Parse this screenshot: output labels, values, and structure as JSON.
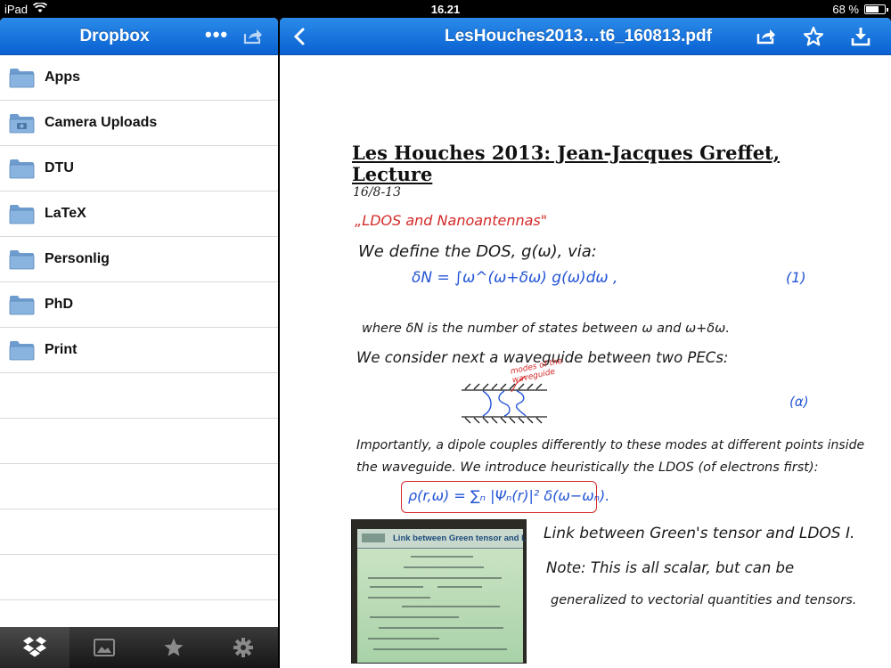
{
  "status_bar": {
    "device": "iPad",
    "time": "16.21",
    "battery": "68 %",
    "battery_level": 0.68
  },
  "sidebar": {
    "title": "Dropbox",
    "more_label": "•••",
    "folders": [
      {
        "label": "Apps",
        "icon": "folder-icon"
      },
      {
        "label": "Camera Uploads",
        "icon": "camera-folder-icon"
      },
      {
        "label": "DTU",
        "icon": "folder-icon"
      },
      {
        "label": "LaTeX",
        "icon": "folder-icon"
      },
      {
        "label": "Personlig",
        "icon": "folder-icon"
      },
      {
        "label": "PhD",
        "icon": "folder-icon"
      },
      {
        "label": "Print",
        "icon": "folder-icon"
      }
    ],
    "tabs": [
      {
        "icon": "dropbox-icon",
        "active": true
      },
      {
        "icon": "photos-icon",
        "active": false
      },
      {
        "icon": "star-icon",
        "active": false
      },
      {
        "icon": "gear-icon",
        "active": false
      }
    ]
  },
  "viewer": {
    "title": "LesHouches2013…t6_160813.pdf",
    "icons": [
      "back-icon",
      "share-icon",
      "star-icon",
      "download-icon"
    ]
  },
  "document": {
    "heading": "Les Houches 2013: Jean-Jacques Greffet, Lecture",
    "date": "16/8-13",
    "notes": {
      "subtitle": "„LDOS and Nanoantennas\"",
      "line1": "We define the DOS, g(ω), via:",
      "eq1": "δN = ∫ω^(ω+δω) g(ω)dω ,",
      "eq1_num": "(1)",
      "line2": "where δN is the number of states between ω and ω+δω.",
      "line3": "We consider next a waveguide between two PECs:",
      "modes_label": "modes of the waveguide",
      "eq_alpha": "(α)",
      "line4": "Importantly, a dipole couples differently to these modes at different points inside",
      "line5": "the waveguide. We introduce heuristically the LDOS (of electrons first):",
      "eq2": "ρ(r,ω) = ∑ₙ |Ψₙ(r)|² δ(ω−ωₙ).",
      "line6": "Link between Green's tensor and LDOS I.",
      "line7": "Note: This is all scalar, but can be",
      "line8": "generalized to vectorial quantities and tensors."
    },
    "slide_title": "Link between Green tensor and LDOS"
  }
}
